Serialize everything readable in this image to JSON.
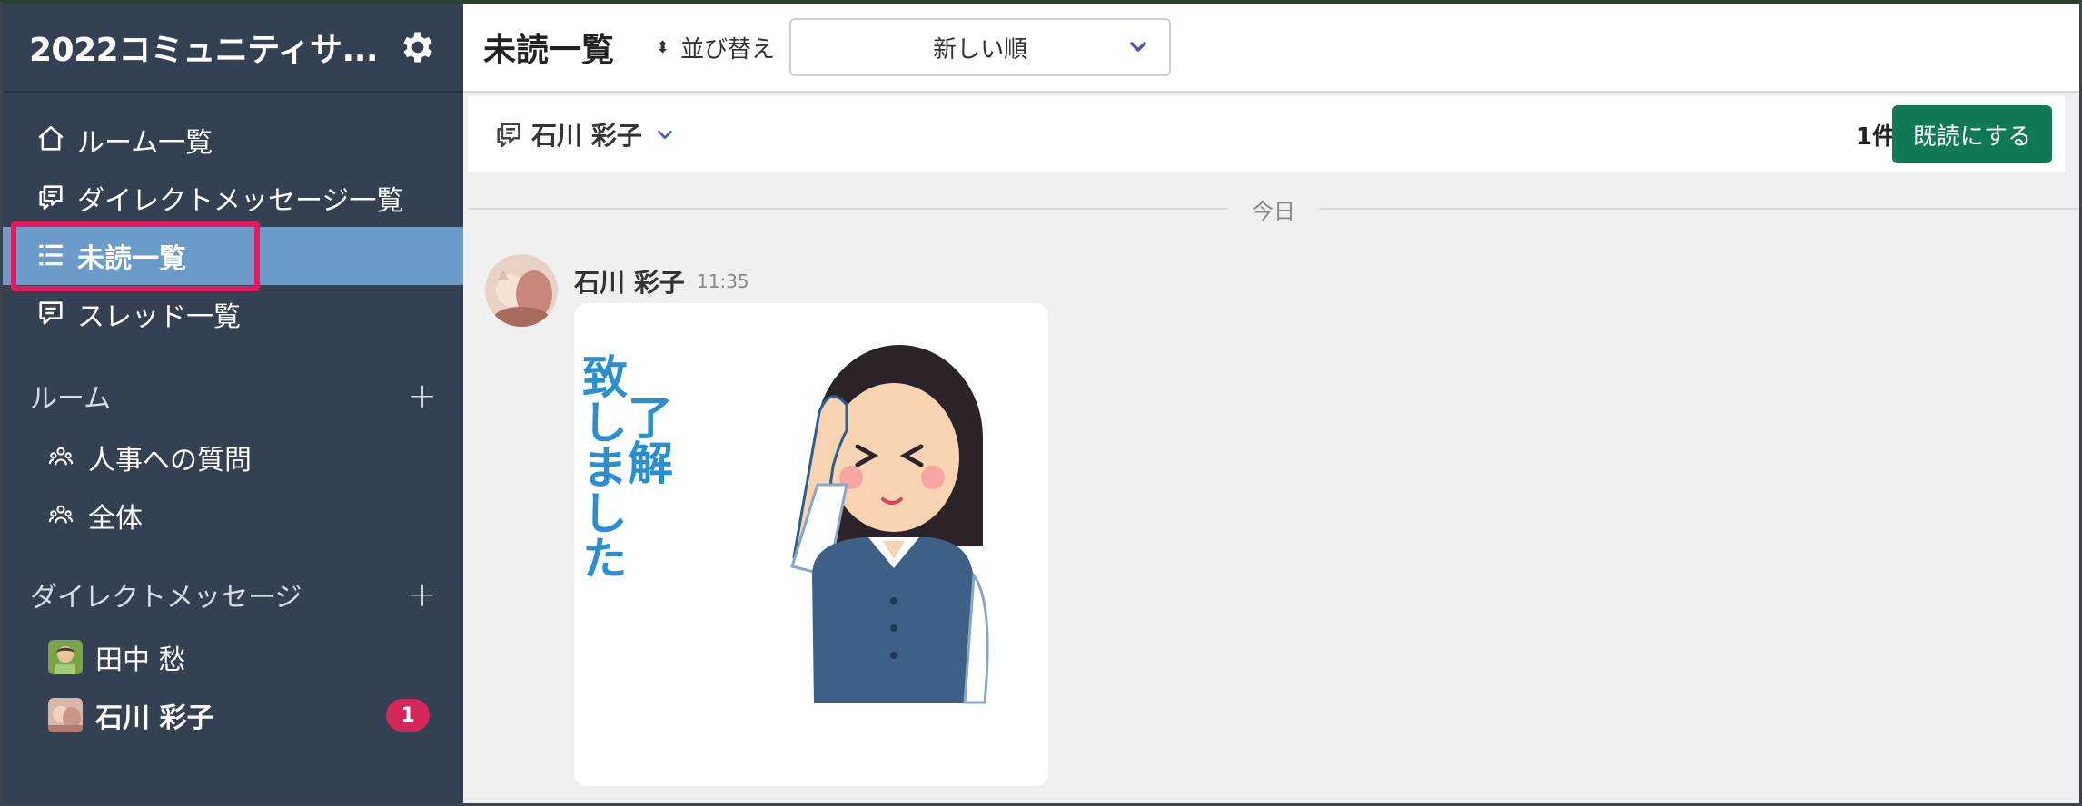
{
  "sidebar": {
    "workspace_title": "2022コミュニティサ...",
    "nav": [
      {
        "label": "ルーム一覧",
        "icon": "home-icon"
      },
      {
        "label": "ダイレクトメッセージ一覧",
        "icon": "direct-message-icon"
      },
      {
        "label": "未読一覧",
        "icon": "list-icon",
        "active": true
      },
      {
        "label": "スレッド一覧",
        "icon": "thread-icon"
      }
    ],
    "rooms_heading": "ルーム",
    "rooms": [
      {
        "label": "人事への質問",
        "icon": "people-icon"
      },
      {
        "label": "全体",
        "icon": "people-icon"
      }
    ],
    "dm_heading": "ダイレクトメッセージ",
    "dms": [
      {
        "label": "田中 愁",
        "unread": null
      },
      {
        "label": "石川 彩子",
        "unread": "1"
      }
    ],
    "add_symbol": "+"
  },
  "main": {
    "title": "未読一覧",
    "sort_label": "並び替え",
    "sort_value": "新しい順",
    "dm_group": {
      "name": "石川 彩子",
      "count": "1件",
      "mark_read_label": "既読にする"
    },
    "date_divider": "今日",
    "message": {
      "author": "石川 彩子",
      "time": "11:35",
      "sticker_text": "了解致しました"
    }
  },
  "colors": {
    "sidebar_bg": "#334152",
    "active_bg": "#6b9bc9",
    "highlight": "#e6195e",
    "badge": "#d7265c",
    "primary_button": "#0f7a54"
  }
}
